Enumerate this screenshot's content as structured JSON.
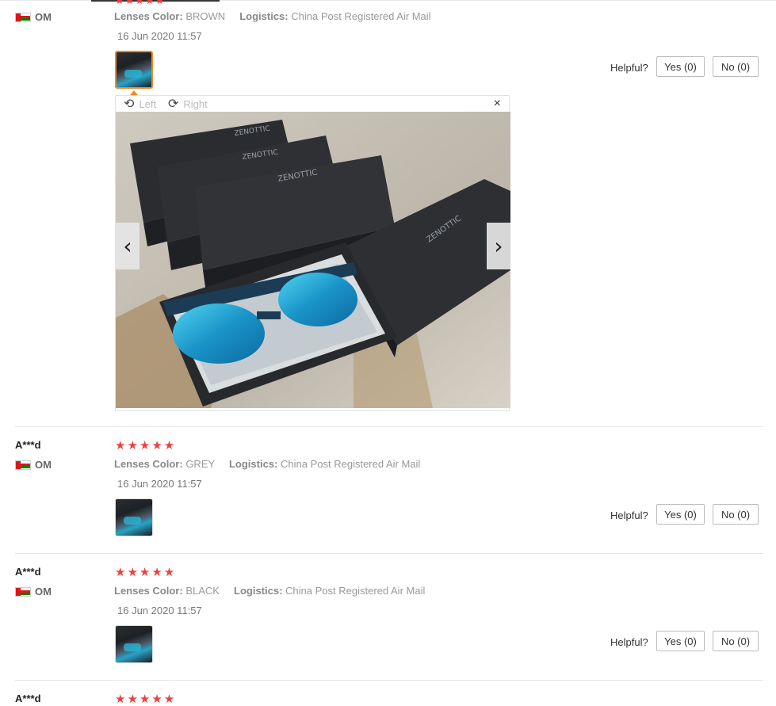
{
  "first_review_tail": {
    "stars": "★★★★★"
  },
  "reviews": [
    {
      "name": "",
      "country": "OM",
      "stars": "",
      "lenses_label": "Lenses Color:",
      "lenses_value": "BROWN",
      "logistics_label": "Logistics:",
      "logistics_value": "China Post Registered Air Mail",
      "date": "16 Jun 2020 11:57",
      "helpful_label": "Helpful?",
      "yes_label": "Yes (0)",
      "no_label": "No (0)"
    },
    {
      "name": "A***d",
      "country": "OM",
      "stars": "★★★★★",
      "lenses_label": "Lenses Color:",
      "lenses_value": "GREY",
      "logistics_label": "Logistics:",
      "logistics_value": "China Post Registered Air Mail",
      "date": "16 Jun 2020 11:57",
      "helpful_label": "Helpful?",
      "yes_label": "Yes (0)",
      "no_label": "No (0)"
    },
    {
      "name": "A***d",
      "country": "OM",
      "stars": "★★★★★",
      "lenses_label": "Lenses Color:",
      "lenses_value": "BLACK",
      "logistics_label": "Logistics:",
      "logistics_value": "China Post Registered Air Mail",
      "date": "16 Jun 2020 11:57",
      "helpful_label": "Helpful?",
      "yes_label": "Yes (0)",
      "no_label": "No (0)"
    },
    {
      "name": "A***d",
      "stars": "★★★★★"
    }
  ],
  "viewer": {
    "rotate_left_label": "Left",
    "rotate_right_label": "Right",
    "rotate_left_icon": "rotate-left-icon",
    "rotate_right_icon": "rotate-right-icon",
    "close_icon": "×",
    "prev_icon": "‹",
    "next_icon": "›",
    "photo_print": "ZENOTTIC"
  },
  "colors": {
    "star": "#ee4040",
    "active_thumb_border": "#f08a24"
  }
}
